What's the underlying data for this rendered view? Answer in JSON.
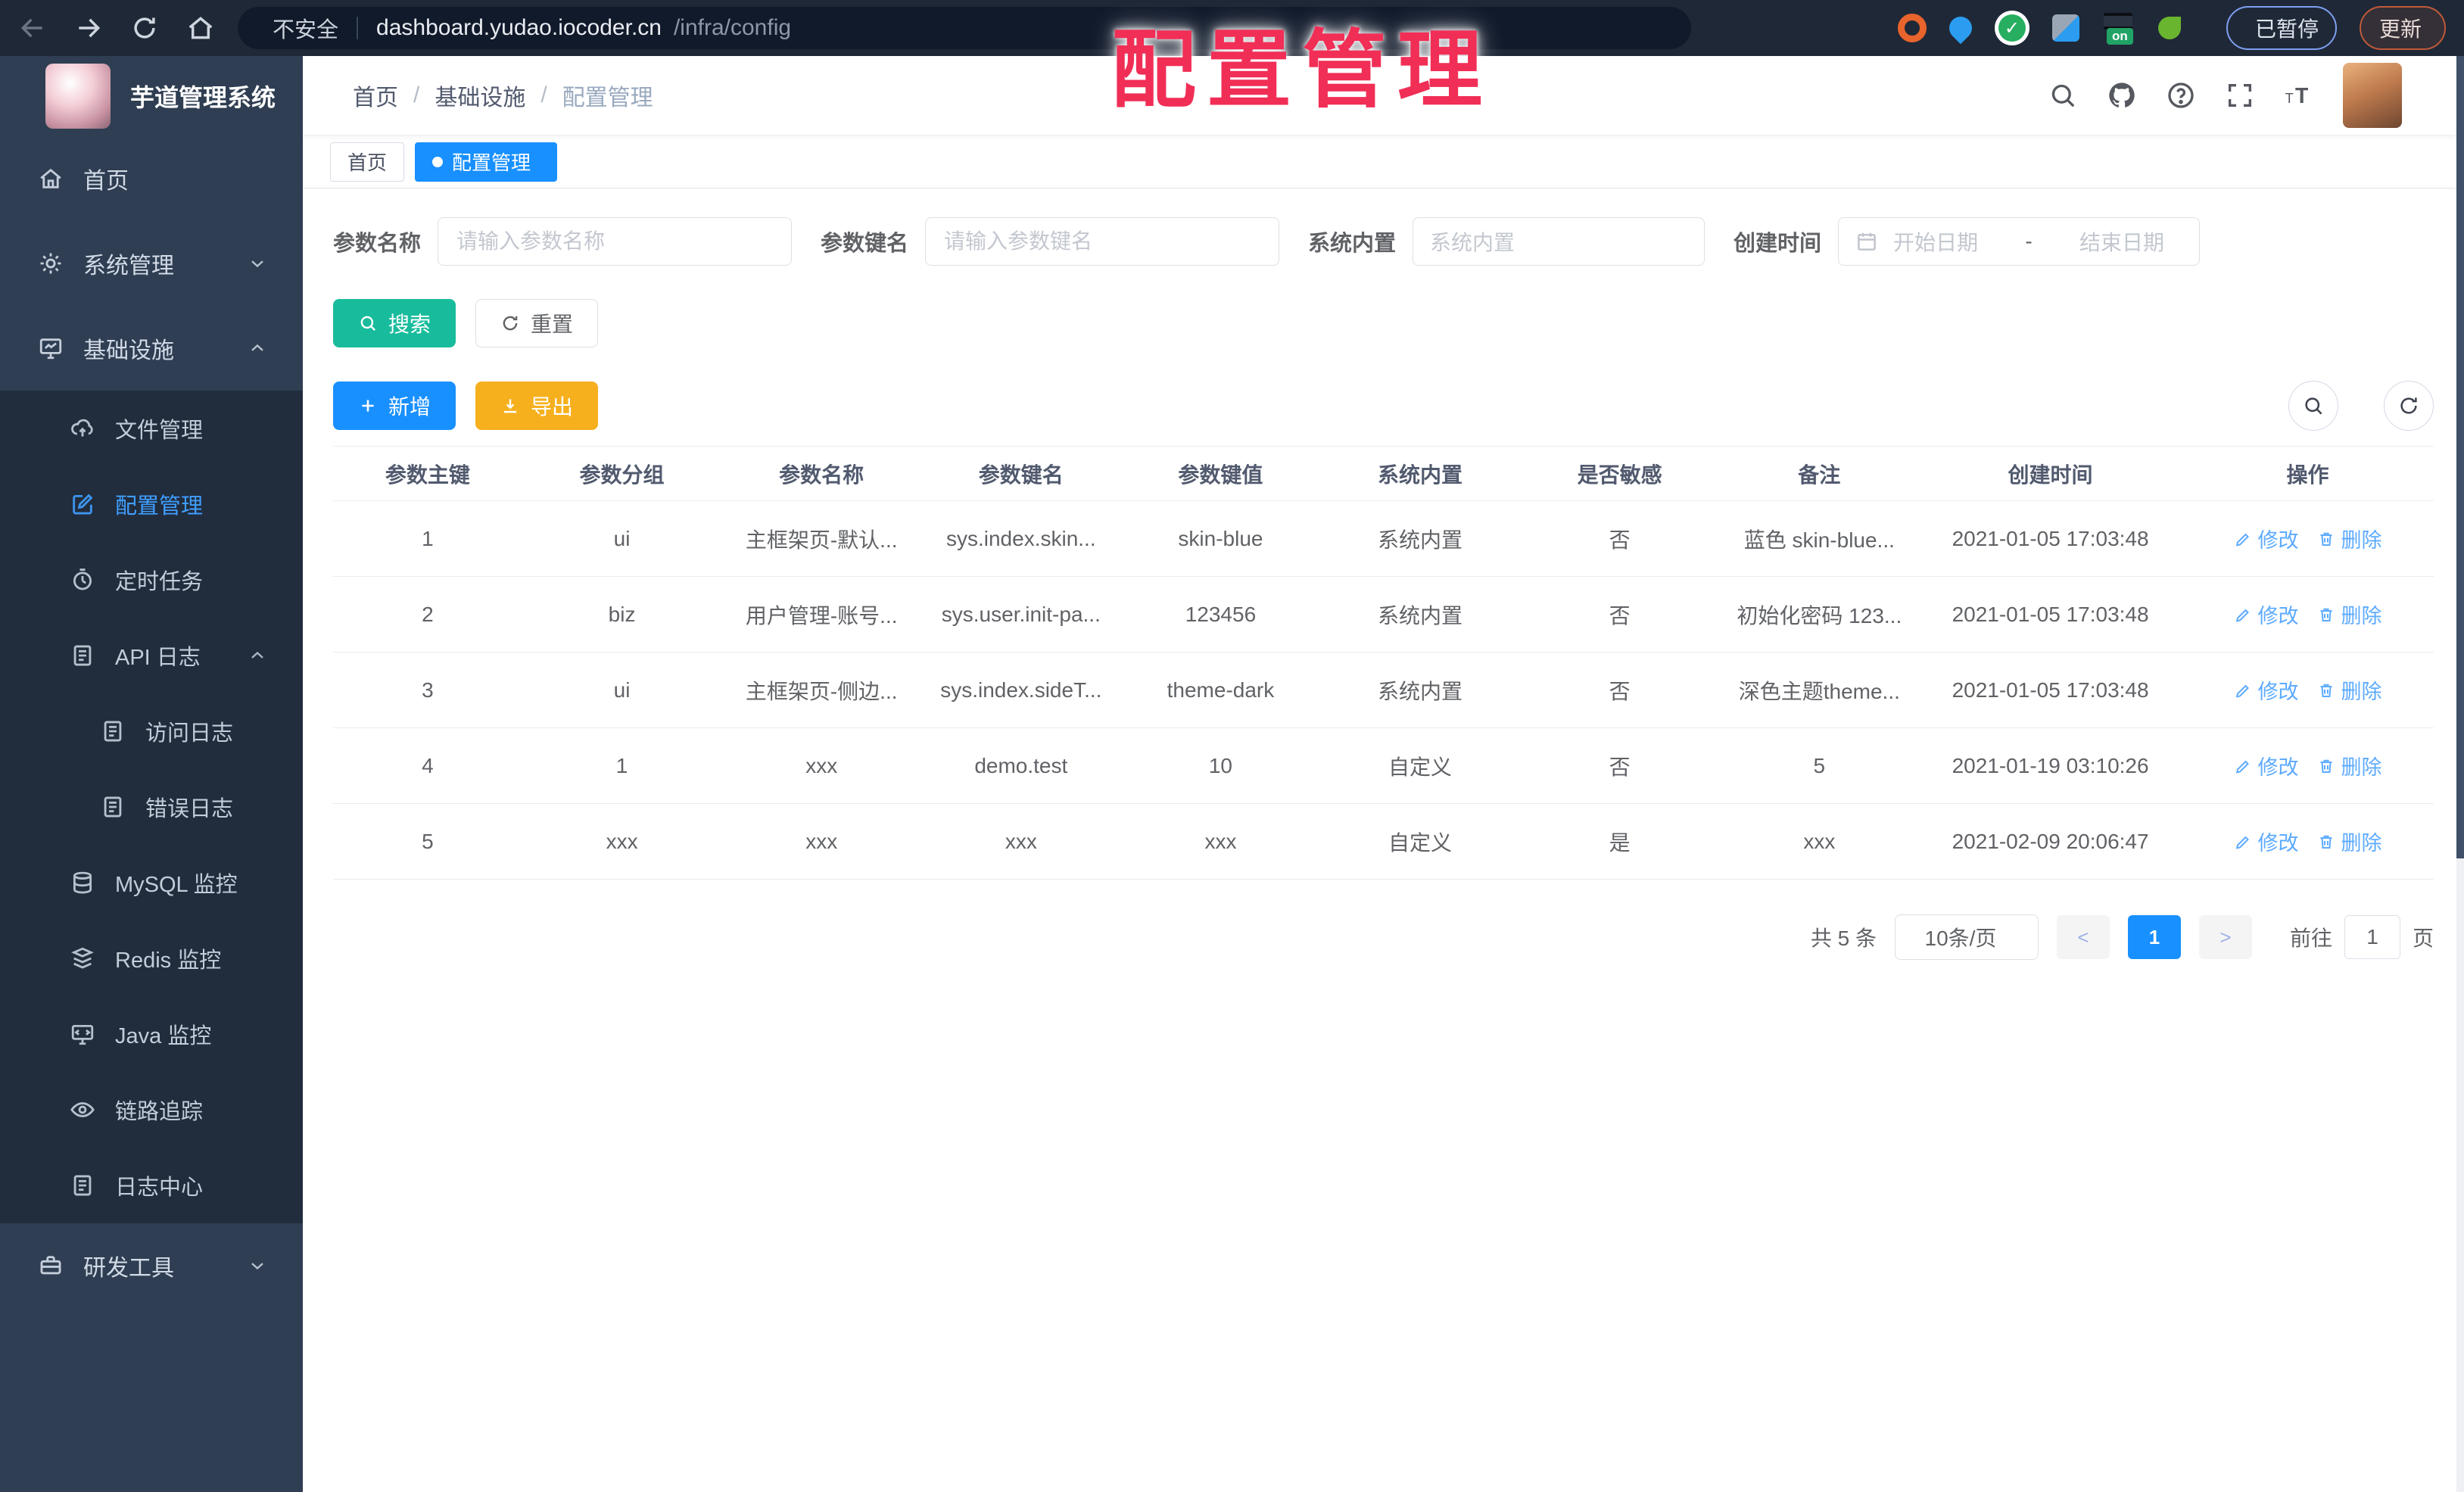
{
  "browser": {
    "security_label": "不安全",
    "url_host": "dashboard.yudao.iocoder.cn",
    "url_path": "/infra/config",
    "on_badge_label": "on",
    "paused_label": "已暂停",
    "update_label": "更新"
  },
  "overlay_title": "配置管理",
  "sidebar": {
    "logo_title": "芋道管理系统",
    "items": [
      {
        "label": "首页",
        "icon": "home-icon",
        "level": 1
      },
      {
        "label": "系统管理",
        "icon": "gear-icon",
        "level": 1,
        "chevron": "down"
      },
      {
        "label": "基础设施",
        "icon": "monitor-icon",
        "level": 1,
        "chevron": "up"
      },
      {
        "label": "文件管理",
        "icon": "cloud-upload-icon",
        "level": 2
      },
      {
        "label": "配置管理",
        "icon": "edit-square-icon",
        "level": 2,
        "active": true
      },
      {
        "label": "定时任务",
        "icon": "timer-icon",
        "level": 2
      },
      {
        "label": "API 日志",
        "icon": "log-icon",
        "level": 2,
        "chevron": "up"
      },
      {
        "label": "访问日志",
        "icon": "log-icon",
        "level": 3
      },
      {
        "label": "错误日志",
        "icon": "log-icon",
        "level": 3
      },
      {
        "label": "MySQL 监控",
        "icon": "mysql-icon",
        "level": 2
      },
      {
        "label": "Redis 监控",
        "icon": "redis-icon",
        "level": 2
      },
      {
        "label": "Java 监控",
        "icon": "java-icon",
        "level": 2
      },
      {
        "label": "链路追踪",
        "icon": "eye-icon",
        "level": 2
      },
      {
        "label": "日志中心",
        "icon": "log-icon",
        "level": 2
      },
      {
        "label": "研发工具",
        "icon": "toolbox-icon",
        "level": 1,
        "chevron": "down"
      }
    ]
  },
  "navbar": {
    "breadcrumb": [
      "首页",
      "基础设施",
      "配置管理"
    ],
    "breadcrumb_separator": "/",
    "icons": [
      "search-icon",
      "github-icon",
      "help-icon",
      "fullscreen-icon",
      "font-size-icon"
    ]
  },
  "tabs": [
    {
      "label": "首页",
      "active": false,
      "closable": false
    },
    {
      "label": "配置管理",
      "active": true,
      "closable": true
    }
  ],
  "filters": {
    "fields": [
      {
        "label": "参数名称",
        "placeholder": "请输入参数名称"
      },
      {
        "label": "参数键名",
        "placeholder": "请输入参数键名"
      },
      {
        "label": "系统内置",
        "placeholder": "系统内置"
      },
      {
        "label": "创建时间",
        "start_placeholder": "开始日期",
        "separator": "-",
        "end_placeholder": "结束日期"
      }
    ],
    "search_label": "搜索",
    "reset_label": "重置"
  },
  "toolbar": {
    "add_label": "新增",
    "export_label": "导出"
  },
  "table": {
    "columns": [
      "参数主键",
      "参数分组",
      "参数名称",
      "参数键名",
      "参数键值",
      "系统内置",
      "是否敏感",
      "备注",
      "创建时间",
      "操作"
    ],
    "edit_label": "修改",
    "delete_label": "删除",
    "rows": [
      {
        "cells": [
          "1",
          "ui",
          "主框架页-默认...",
          "sys.index.skin...",
          "skin-blue",
          "系统内置",
          "否",
          "蓝色 skin-blue...",
          "2021-01-05 17:03:48"
        ]
      },
      {
        "cells": [
          "2",
          "biz",
          "用户管理-账号...",
          "sys.user.init-pa...",
          "123456",
          "系统内置",
          "否",
          "初始化密码 123...",
          "2021-01-05 17:03:48"
        ]
      },
      {
        "cells": [
          "3",
          "ui",
          "主框架页-侧边...",
          "sys.index.sideT...",
          "theme-dark",
          "系统内置",
          "否",
          "深色主题theme...",
          "2021-01-05 17:03:48"
        ]
      },
      {
        "cells": [
          "4",
          "1",
          "xxx",
          "demo.test",
          "10",
          "自定义",
          "否",
          "5",
          "2021-01-19 03:10:26"
        ]
      },
      {
        "cells": [
          "5",
          "xxx",
          "xxx",
          "xxx",
          "xxx",
          "自定义",
          "是",
          "xxx",
          "2021-02-09 20:06:47"
        ]
      }
    ]
  },
  "pagination": {
    "total_label": "共 5 条",
    "page_size_label": "10条/页",
    "prev_label": "<",
    "current_page": "1",
    "next_label": ">",
    "goto_label": "前往",
    "goto_value": "1",
    "page_unit_label": "页"
  },
  "colors": {
    "accent_blue": "#1890ff",
    "sidebar_active_blue": "#409eff",
    "search_teal": "#18bc9c",
    "export_amber": "#f6b01e",
    "overlay_red": "#f12e56"
  }
}
